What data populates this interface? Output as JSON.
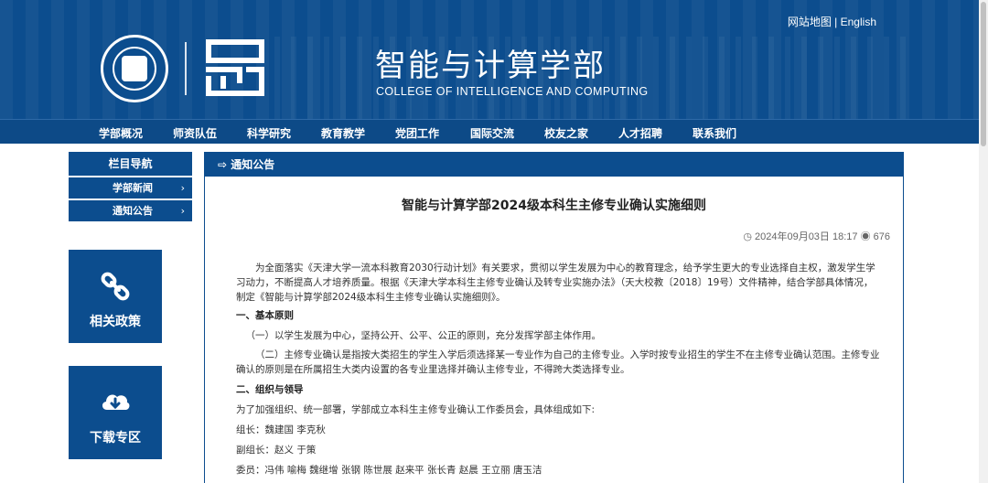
{
  "header": {
    "top_links": "网站地图 | English",
    "title_cn": "智能与计算学部",
    "title_en": "COLLEGE OF INTELLIGENCE AND COMPUTING",
    "brand_color": "#0c4d8e"
  },
  "nav": {
    "items": [
      "学部概况",
      "师资队伍",
      "科学研究",
      "教育教学",
      "党团工作",
      "国际交流",
      "校友之家",
      "人才招聘",
      "联系我们"
    ]
  },
  "sidebar": {
    "title": "栏目导航",
    "items": [
      {
        "label": "学部新闻",
        "icon": "chevron-right-icon"
      },
      {
        "label": "通知公告",
        "icon": "chevron-right-icon"
      }
    ],
    "tiles": [
      {
        "label": "相关政策",
        "icon": "link-icon"
      },
      {
        "label": "下载专区",
        "icon": "cloud-download-icon"
      }
    ]
  },
  "panel": {
    "header": "通知公告",
    "title": "智能与计算学部2024级本科生主修专业确认实施细则",
    "date": "2024年09月03日 18:17",
    "views": "676",
    "paragraphs": {
      "p1": "为全面落实《天津大学一流本科教育2030行动计划》有关要求，贯彻以学生发展为中心的教育理念，给予学生更大的专业选择自主权，激发学生学习动力，不断提高人才培养质量。根据《天津大学本科生主修专业确认及转专业实施办法》（天大校教〔2018〕19号）文件精神，结合学部具体情况，制定《智能与计算学部2024级本科生主修专业确认实施细则》。",
      "h1": "一、基本原则",
      "p2": "（一）以学生发展为中心，坚持公开、公平、公正的原则，充分发挥学部主体作用。",
      "p3": "（二）主修专业确认是指按大类招生的学生入学后须选择某一专业作为自己的主修专业。入学时按专业招生的学生不在主修专业确认范围。主修专业确认的原则是在所属招生大类内设置的各专业里选择并确认主修专业，不得跨大类选择专业。",
      "h2": "二、组织与领导",
      "p4": "为了加强组织、统一部署，学部成立本科生主修专业确认工作委员会，具体组成如下:",
      "p5": "组长：魏建国 李克秋",
      "p6": "副组长：赵义 于策",
      "p7": "委员：冯伟 喻梅 魏继增 张钢 陈世展 赵来平 张长青 赵晨 王立丽 唐玉洁"
    }
  }
}
